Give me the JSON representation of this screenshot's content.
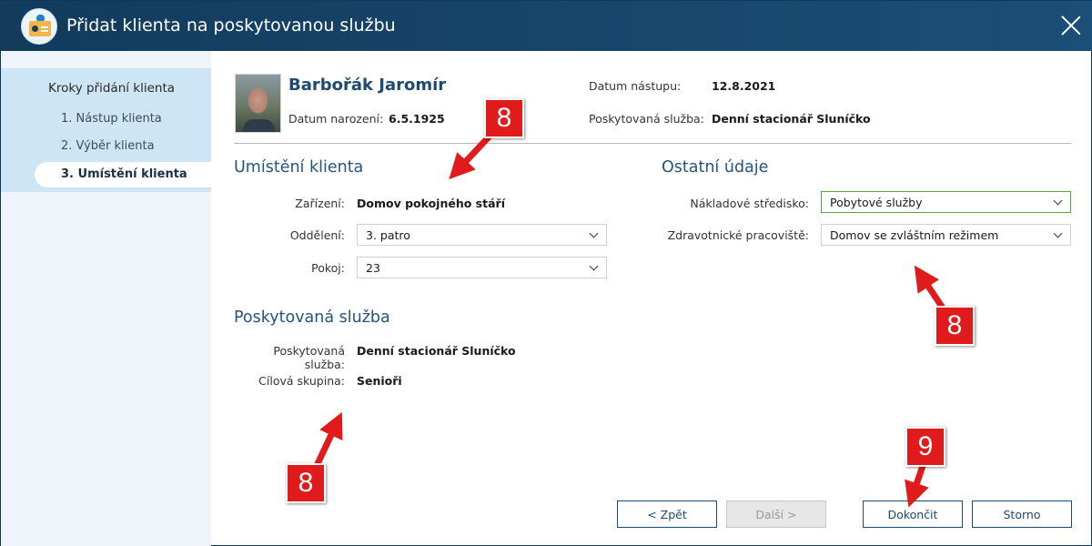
{
  "window": {
    "title": "Přidat klienta na poskytovanou službu"
  },
  "sidebar": {
    "heading": "Kroky přidání klienta",
    "steps": [
      {
        "label": "1. Nástup klienta"
      },
      {
        "label": "2. Výběr klienta"
      },
      {
        "label": "3. Umístění klienta",
        "active": true
      }
    ]
  },
  "client": {
    "name": "Barbořák Jaromír",
    "birth_label": "Datum narození:",
    "birth_value": "6.5.1925",
    "start_label": "Datum nástupu:",
    "start_value": "12.8.2021",
    "service_label": "Poskytovaná služba:",
    "service_value": "Denní stacionář Sluníčko"
  },
  "placement": {
    "heading": "Umístění klienta",
    "facility_label": "Zařízení:",
    "facility_value": "Domov pokojného stáří",
    "department_label": "Oddělení:",
    "department_value": "3. patro",
    "room_label": "Pokoj:",
    "room_value": "23"
  },
  "other": {
    "heading": "Ostatní údaje",
    "cost_center_label": "Nákladové středisko:",
    "cost_center_value": "Pobytové služby",
    "health_label": "Zdravotnické pracoviště:",
    "health_value": "Domov se zvláštním režimem"
  },
  "service": {
    "heading": "Poskytovaná služba",
    "service_label": "Poskytovaná služba:",
    "service_value": "Denní stacionář Sluníčko",
    "group_label": "Cílová skupina:",
    "group_value": "Senioři"
  },
  "buttons": {
    "back": "< Zpět",
    "next": "Další >",
    "finish": "Dokončit",
    "cancel": "Storno"
  },
  "annotations": [
    {
      "text": "8"
    },
    {
      "text": "8"
    },
    {
      "text": "8"
    },
    {
      "text": "9"
    }
  ],
  "colors": {
    "titlebar": "#123b5c",
    "accent": "#25557d",
    "badge": "#e11b1b",
    "focus": "#5ca23a"
  }
}
